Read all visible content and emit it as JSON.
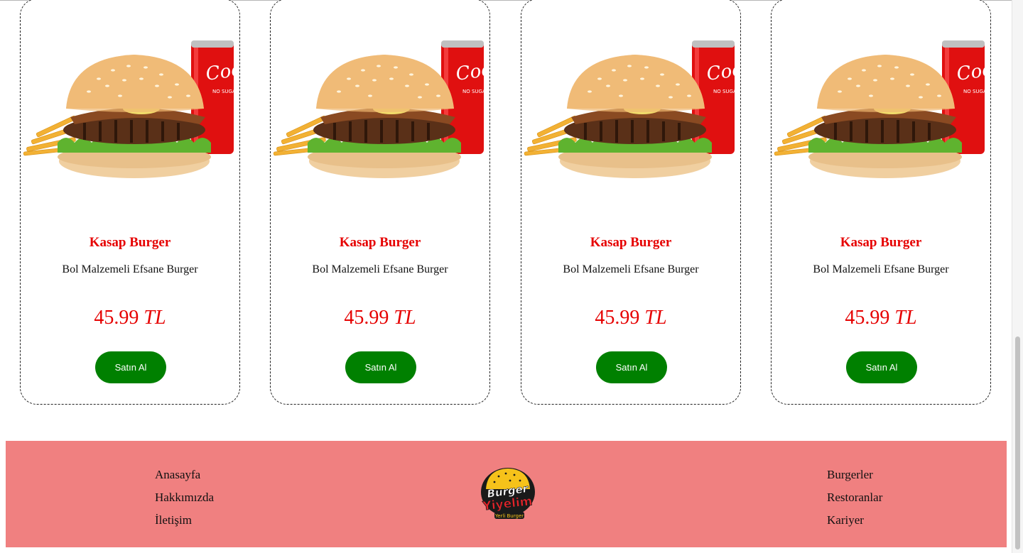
{
  "products": [
    {
      "title": "Kasap Burger",
      "description": "Bol Malzemeli Efsane Burger",
      "price_value": "45.99",
      "currency": "TL",
      "buy_label": "Satın Al",
      "can_text": "Coca-Cola",
      "can_subtext": "NO SUGAR"
    },
    {
      "title": "Kasap Burger",
      "description": "Bol Malzemeli Efsane Burger",
      "price_value": "45.99",
      "currency": "TL",
      "buy_label": "Satın Al",
      "can_text": "Coca-Cola",
      "can_subtext": "NO SUGAR"
    },
    {
      "title": "Kasap Burger",
      "description": "Bol Malzemeli Efsane Burger",
      "price_value": "45.99",
      "currency": "TL",
      "buy_label": "Satın Al",
      "can_text": "Coca-Cola",
      "can_subtext": "NO SUGAR"
    },
    {
      "title": "Kasap Burger",
      "description": "Bol Malzemeli Efsane Burger",
      "price_value": "45.99",
      "currency": "TL",
      "buy_label": "Satın Al",
      "can_text": "Coca-Cola",
      "can_subtext": "NO SUGAR"
    }
  ],
  "footer": {
    "left_links": [
      "Anasayfa",
      "Hakkımızda",
      "İletişim"
    ],
    "right_links": [
      "Burgerler",
      "Restoranlar",
      "Kariyer"
    ],
    "logo": {
      "line1": "Burger",
      "line2": "Yiyelim",
      "tagline": "Yerli Burger"
    }
  },
  "colors": {
    "accent_red": "#e60000",
    "button_green": "#008000",
    "footer_bg": "#f08080"
  },
  "scroll": {
    "position_fraction": 0.61
  }
}
